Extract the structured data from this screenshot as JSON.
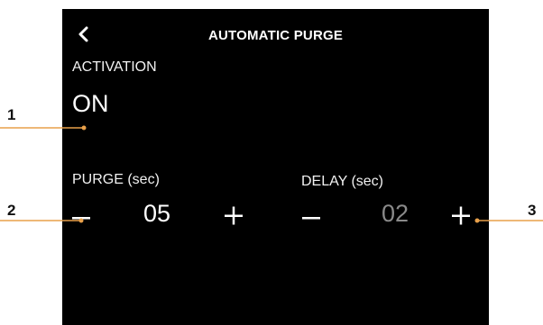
{
  "header": {
    "title": "AUTOMATIC PURGE",
    "back_icon": "chevron-left-icon"
  },
  "activation": {
    "label": "ACTIVATION",
    "value": "ON"
  },
  "purge": {
    "label": "PURGE (sec)",
    "value": "05",
    "decrease_icon": "minus-icon",
    "increase_icon": "plus-icon"
  },
  "delay": {
    "label": "DELAY (sec)",
    "value": "02",
    "decrease_icon": "minus-icon",
    "increase_icon": "plus-icon"
  },
  "callouts": [
    "1",
    "2",
    "3"
  ],
  "colors": {
    "screen_bg": "#000000",
    "text": "#ffffff",
    "dim_value": "#8a8a8a",
    "callout_line": "#e8a04a"
  }
}
